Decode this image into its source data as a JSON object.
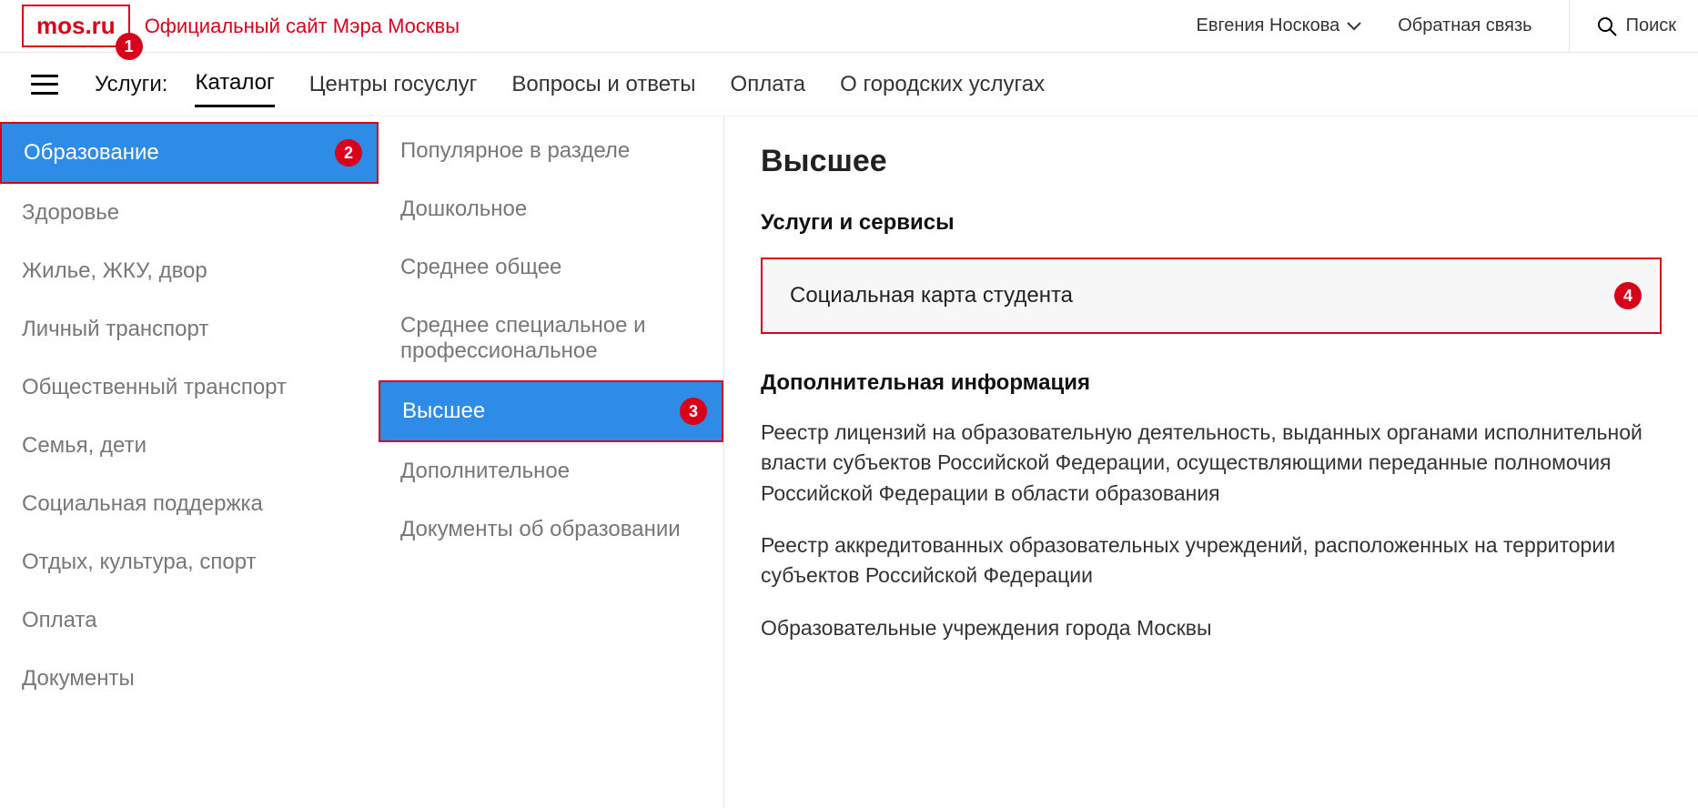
{
  "header": {
    "logo": "mos.ru",
    "tagline": "Официальный сайт Мэра Москвы",
    "user_name": "Евгения Носкова",
    "feedback": "Обратная связь",
    "search_label": "Поиск"
  },
  "nav": {
    "label": "Услуги:",
    "items": [
      {
        "label": "Каталог",
        "active": true
      },
      {
        "label": "Центры госуслуг",
        "active": false
      },
      {
        "label": "Вопросы и ответы",
        "active": false
      },
      {
        "label": "Оплата",
        "active": false
      },
      {
        "label": "О городских услугах",
        "active": false
      }
    ]
  },
  "annotations": {
    "logo": "1",
    "category": "2",
    "subcategory": "3",
    "service": "4"
  },
  "categories": [
    {
      "label": "Образование",
      "active": true
    },
    {
      "label": "Здоровье",
      "active": false
    },
    {
      "label": "Жилье, ЖКУ, двор",
      "active": false
    },
    {
      "label": "Личный транспорт",
      "active": false
    },
    {
      "label": "Общественный транспорт",
      "active": false
    },
    {
      "label": "Семья, дети",
      "active": false
    },
    {
      "label": "Социальная поддержка",
      "active": false
    },
    {
      "label": "Отдых, культура, спорт",
      "active": false
    },
    {
      "label": "Оплата",
      "active": false
    },
    {
      "label": "Документы",
      "active": false
    }
  ],
  "subcategories": [
    {
      "label": "Популярное в разделе",
      "active": false
    },
    {
      "label": "Дошкольное",
      "active": false
    },
    {
      "label": "Среднее общее",
      "active": false
    },
    {
      "label": "Среднее специальное и профессиональное",
      "active": false
    },
    {
      "label": "Высшее",
      "active": true
    },
    {
      "label": "Дополнительное",
      "active": false
    },
    {
      "label": "Документы об образовании",
      "active": false
    }
  ],
  "panel": {
    "title": "Высшее",
    "services_heading": "Услуги и сервисы",
    "service_item": "Социальная карта студента",
    "info_heading": "Дополнительная информация",
    "info_paragraphs": [
      "Реестр лицензий на образовательную деятельность, выданных органами исполнительной власти субъектов Российской Федерации, осуществляющими переданные полномочия Российской Федерации в области образования",
      "Реестр аккредитованных образовательных учреждений, расположенных на территории субъектов Российской Федерации",
      "Образовательные учреждения города Москвы"
    ]
  }
}
